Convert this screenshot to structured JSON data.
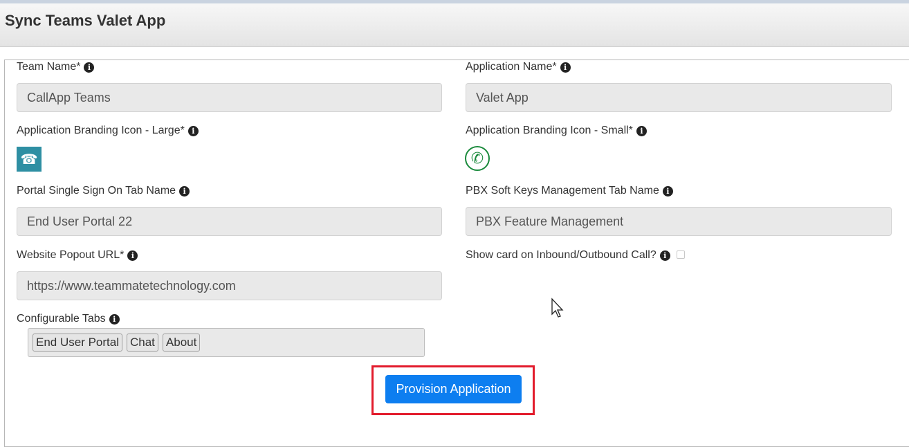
{
  "header": {
    "title": "Sync Teams Valet App"
  },
  "form": {
    "team_name": {
      "label": "Team Name*",
      "value": "CallApp Teams"
    },
    "application_name": {
      "label": "Application Name*",
      "value": "Valet App"
    },
    "branding_large": {
      "label": "Application Branding Icon - Large*",
      "icon": "telephone-icon",
      "color": "#2e8fa3"
    },
    "branding_small": {
      "label": "Application Branding Icon - Small*",
      "icon": "phone-handset-icon",
      "color": "#1a8a3c"
    },
    "portal_sso_tab": {
      "label": "Portal Single Sign On Tab Name",
      "value": "End User Portal 22"
    },
    "pbx_soft_keys_tab": {
      "label": "PBX Soft Keys Management Tab Name",
      "value": "PBX Feature Management"
    },
    "website_popout_url": {
      "label": "Website Popout URL*",
      "value": "https://www.teammatetechnology.com"
    },
    "show_card": {
      "label": "Show card on Inbound/Outbound Call?",
      "checked": false
    },
    "configurable_tabs": {
      "label": "Configurable Tabs",
      "tabs": [
        "End User Portal",
        "Chat",
        "About"
      ]
    }
  },
  "provision_button": {
    "label": "Provision Application",
    "color": "#0d7ef0",
    "highlight_color": "#e21b2c"
  }
}
